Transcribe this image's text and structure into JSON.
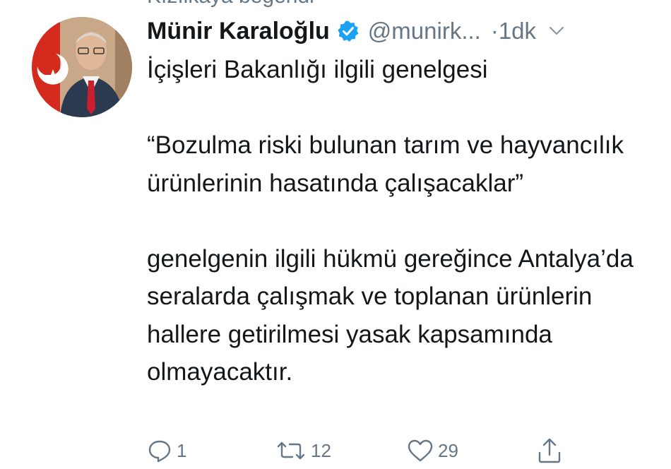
{
  "social_context": "Kızılkaya beğendi",
  "tweet": {
    "author_name": "Münir Karaloğlu",
    "handle": "@munirk...",
    "time": "·1dk",
    "paragraphs": [
      "İçişleri Bakanlığı ilgili genelgesi",
      "“Bozulma riski bulunan tarım ve hayvancılık ürünlerinin hasatında çalışacaklar”",
      "genelgenin ilgili hükmü gereğince Antalya’da seralarda çalışmak ve toplanan ürünlerin hallere getirilmesi yasak kapsamında olmayacaktır."
    ]
  },
  "actions": {
    "reply_count": "1",
    "retweet_count": "12",
    "like_count": "29"
  },
  "icons": {
    "verified": "verified-badge-icon",
    "more": "chevron-down-icon",
    "reply": "reply-icon",
    "retweet": "retweet-icon",
    "like": "heart-icon",
    "share": "share-icon"
  },
  "colors": {
    "text": "#14171a",
    "secondary": "#657786",
    "verified": "#1da1f2"
  }
}
